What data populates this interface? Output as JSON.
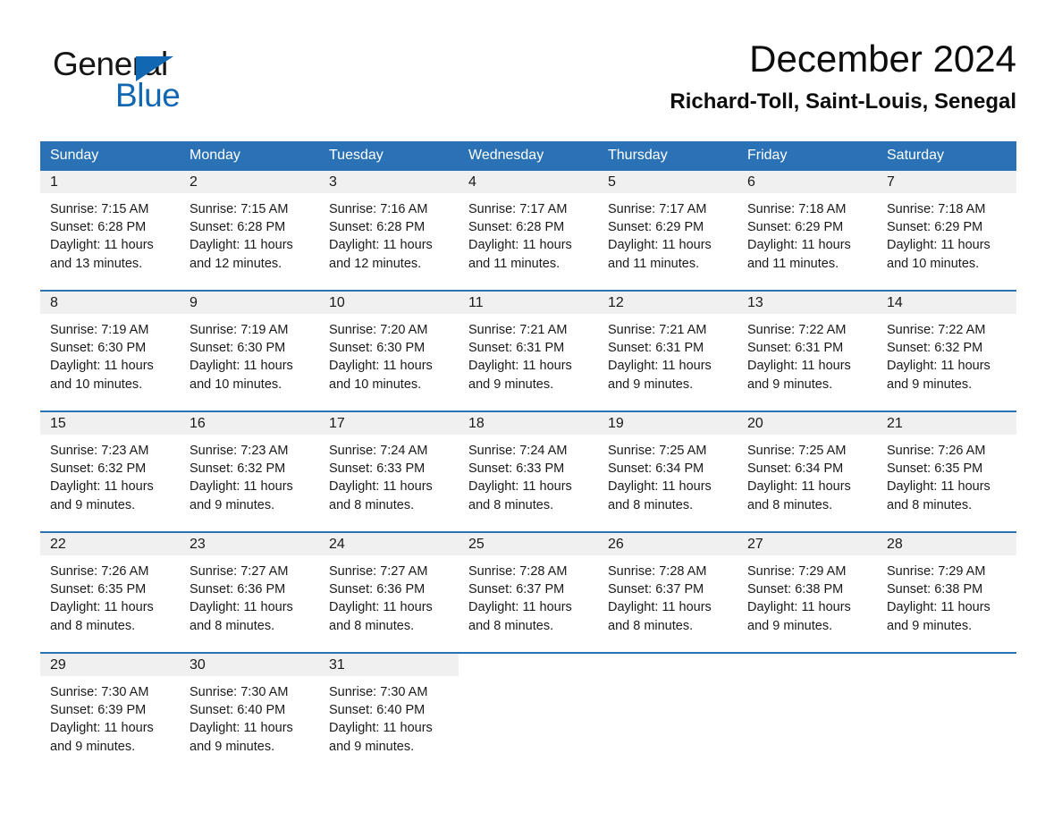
{
  "brand": {
    "name_part1": "General",
    "name_part2": "Blue",
    "triangle_icon": "blue-triangle-icon",
    "accent_color": "#1267b2"
  },
  "header": {
    "month_title": "December 2024",
    "location": "Richard-Toll, Saint-Louis, Senegal"
  },
  "calendar": {
    "header_bg_color": "#2a72b5",
    "daynum_band_color": "#f0f0f0",
    "weekdays": [
      "Sunday",
      "Monday",
      "Tuesday",
      "Wednesday",
      "Thursday",
      "Friday",
      "Saturday"
    ],
    "labels": {
      "sunrise_prefix": "Sunrise:",
      "sunset_prefix": "Sunset:",
      "daylight_prefix": "Daylight:"
    },
    "weeks": [
      [
        {
          "day": "1",
          "sunrise": "Sunrise: 7:15 AM",
          "sunset": "Sunset: 6:28 PM",
          "daylight": "Daylight: 11 hours and 13 minutes."
        },
        {
          "day": "2",
          "sunrise": "Sunrise: 7:15 AM",
          "sunset": "Sunset: 6:28 PM",
          "daylight": "Daylight: 11 hours and 12 minutes."
        },
        {
          "day": "3",
          "sunrise": "Sunrise: 7:16 AM",
          "sunset": "Sunset: 6:28 PM",
          "daylight": "Daylight: 11 hours and 12 minutes."
        },
        {
          "day": "4",
          "sunrise": "Sunrise: 7:17 AM",
          "sunset": "Sunset: 6:28 PM",
          "daylight": "Daylight: 11 hours and 11 minutes."
        },
        {
          "day": "5",
          "sunrise": "Sunrise: 7:17 AM",
          "sunset": "Sunset: 6:29 PM",
          "daylight": "Daylight: 11 hours and 11 minutes."
        },
        {
          "day": "6",
          "sunrise": "Sunrise: 7:18 AM",
          "sunset": "Sunset: 6:29 PM",
          "daylight": "Daylight: 11 hours and 11 minutes."
        },
        {
          "day": "7",
          "sunrise": "Sunrise: 7:18 AM",
          "sunset": "Sunset: 6:29 PM",
          "daylight": "Daylight: 11 hours and 10 minutes."
        }
      ],
      [
        {
          "day": "8",
          "sunrise": "Sunrise: 7:19 AM",
          "sunset": "Sunset: 6:30 PM",
          "daylight": "Daylight: 11 hours and 10 minutes."
        },
        {
          "day": "9",
          "sunrise": "Sunrise: 7:19 AM",
          "sunset": "Sunset: 6:30 PM",
          "daylight": "Daylight: 11 hours and 10 minutes."
        },
        {
          "day": "10",
          "sunrise": "Sunrise: 7:20 AM",
          "sunset": "Sunset: 6:30 PM",
          "daylight": "Daylight: 11 hours and 10 minutes."
        },
        {
          "day": "11",
          "sunrise": "Sunrise: 7:21 AM",
          "sunset": "Sunset: 6:31 PM",
          "daylight": "Daylight: 11 hours and 9 minutes."
        },
        {
          "day": "12",
          "sunrise": "Sunrise: 7:21 AM",
          "sunset": "Sunset: 6:31 PM",
          "daylight": "Daylight: 11 hours and 9 minutes."
        },
        {
          "day": "13",
          "sunrise": "Sunrise: 7:22 AM",
          "sunset": "Sunset: 6:31 PM",
          "daylight": "Daylight: 11 hours and 9 minutes."
        },
        {
          "day": "14",
          "sunrise": "Sunrise: 7:22 AM",
          "sunset": "Sunset: 6:32 PM",
          "daylight": "Daylight: 11 hours and 9 minutes."
        }
      ],
      [
        {
          "day": "15",
          "sunrise": "Sunrise: 7:23 AM",
          "sunset": "Sunset: 6:32 PM",
          "daylight": "Daylight: 11 hours and 9 minutes."
        },
        {
          "day": "16",
          "sunrise": "Sunrise: 7:23 AM",
          "sunset": "Sunset: 6:32 PM",
          "daylight": "Daylight: 11 hours and 9 minutes."
        },
        {
          "day": "17",
          "sunrise": "Sunrise: 7:24 AM",
          "sunset": "Sunset: 6:33 PM",
          "daylight": "Daylight: 11 hours and 8 minutes."
        },
        {
          "day": "18",
          "sunrise": "Sunrise: 7:24 AM",
          "sunset": "Sunset: 6:33 PM",
          "daylight": "Daylight: 11 hours and 8 minutes."
        },
        {
          "day": "19",
          "sunrise": "Sunrise: 7:25 AM",
          "sunset": "Sunset: 6:34 PM",
          "daylight": "Daylight: 11 hours and 8 minutes."
        },
        {
          "day": "20",
          "sunrise": "Sunrise: 7:25 AM",
          "sunset": "Sunset: 6:34 PM",
          "daylight": "Daylight: 11 hours and 8 minutes."
        },
        {
          "day": "21",
          "sunrise": "Sunrise: 7:26 AM",
          "sunset": "Sunset: 6:35 PM",
          "daylight": "Daylight: 11 hours and 8 minutes."
        }
      ],
      [
        {
          "day": "22",
          "sunrise": "Sunrise: 7:26 AM",
          "sunset": "Sunset: 6:35 PM",
          "daylight": "Daylight: 11 hours and 8 minutes."
        },
        {
          "day": "23",
          "sunrise": "Sunrise: 7:27 AM",
          "sunset": "Sunset: 6:36 PM",
          "daylight": "Daylight: 11 hours and 8 minutes."
        },
        {
          "day": "24",
          "sunrise": "Sunrise: 7:27 AM",
          "sunset": "Sunset: 6:36 PM",
          "daylight": "Daylight: 11 hours and 8 minutes."
        },
        {
          "day": "25",
          "sunrise": "Sunrise: 7:28 AM",
          "sunset": "Sunset: 6:37 PM",
          "daylight": "Daylight: 11 hours and 8 minutes."
        },
        {
          "day": "26",
          "sunrise": "Sunrise: 7:28 AM",
          "sunset": "Sunset: 6:37 PM",
          "daylight": "Daylight: 11 hours and 8 minutes."
        },
        {
          "day": "27",
          "sunrise": "Sunrise: 7:29 AM",
          "sunset": "Sunset: 6:38 PM",
          "daylight": "Daylight: 11 hours and 9 minutes."
        },
        {
          "day": "28",
          "sunrise": "Sunrise: 7:29 AM",
          "sunset": "Sunset: 6:38 PM",
          "daylight": "Daylight: 11 hours and 9 minutes."
        }
      ],
      [
        {
          "day": "29",
          "sunrise": "Sunrise: 7:30 AM",
          "sunset": "Sunset: 6:39 PM",
          "daylight": "Daylight: 11 hours and 9 minutes."
        },
        {
          "day": "30",
          "sunrise": "Sunrise: 7:30 AM",
          "sunset": "Sunset: 6:40 PM",
          "daylight": "Daylight: 11 hours and 9 minutes."
        },
        {
          "day": "31",
          "sunrise": "Sunrise: 7:30 AM",
          "sunset": "Sunset: 6:40 PM",
          "daylight": "Daylight: 11 hours and 9 minutes."
        },
        {
          "day": "",
          "sunrise": "",
          "sunset": "",
          "daylight": ""
        },
        {
          "day": "",
          "sunrise": "",
          "sunset": "",
          "daylight": ""
        },
        {
          "day": "",
          "sunrise": "",
          "sunset": "",
          "daylight": ""
        },
        {
          "day": "",
          "sunrise": "",
          "sunset": "",
          "daylight": ""
        }
      ]
    ]
  }
}
